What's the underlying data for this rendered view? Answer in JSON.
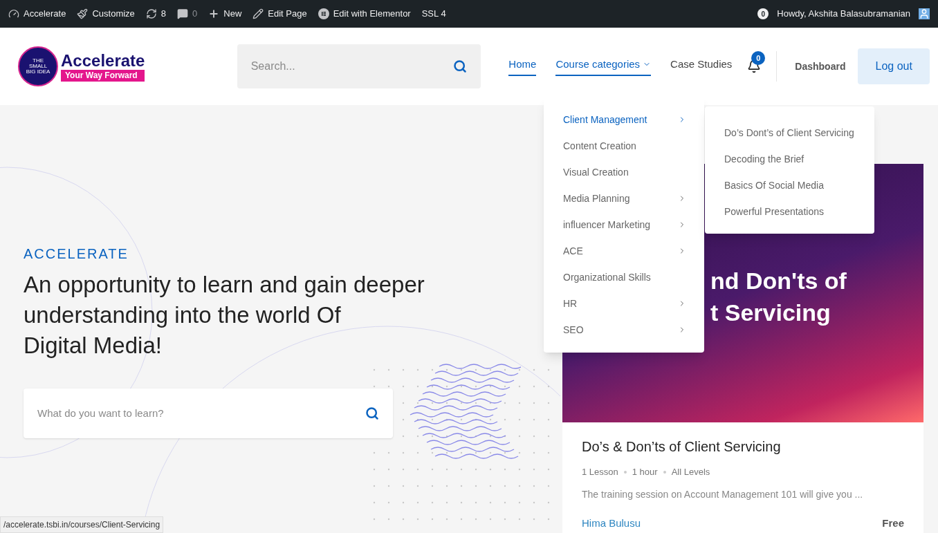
{
  "admin_bar": {
    "items": [
      {
        "kind": "site",
        "label": "Accelerate"
      },
      {
        "kind": "customize",
        "label": "Customize"
      },
      {
        "kind": "updates",
        "label": "8"
      },
      {
        "kind": "comments",
        "label": "0"
      },
      {
        "kind": "new",
        "label": "New"
      },
      {
        "kind": "edit",
        "label": "Edit Page"
      },
      {
        "kind": "elementor",
        "label": "Edit with Elementor"
      },
      {
        "kind": "text",
        "label": "SSL 4"
      }
    ],
    "notifications": "0",
    "greeting": "Howdy, Akshita Balasubramanian"
  },
  "header": {
    "logo": {
      "title": "Accelerate",
      "tagline": "Your Way Forward",
      "mark_lines": [
        "THE",
        "SMALL",
        "BIG IDEA"
      ]
    },
    "search": {
      "placeholder": "Search..."
    },
    "nav": [
      {
        "label": "Home",
        "active": true,
        "has_caret": false
      },
      {
        "label": "Course categories",
        "active": true,
        "has_caret": true
      },
      {
        "label": "Case Studies",
        "active": false,
        "has_caret": false
      }
    ],
    "bell_count": "0",
    "dashboard": "Dashboard",
    "logout": "Log out"
  },
  "menu": {
    "items": [
      {
        "label": "Client Management",
        "selected": true,
        "has_submenu": true
      },
      {
        "label": "Content Creation",
        "selected": false,
        "has_submenu": false
      },
      {
        "label": "Visual Creation",
        "selected": false,
        "has_submenu": false
      },
      {
        "label": "Media Planning",
        "selected": false,
        "has_submenu": true
      },
      {
        "label": "influencer Marketing",
        "selected": false,
        "has_submenu": true
      },
      {
        "label": "ACE",
        "selected": false,
        "has_submenu": true
      },
      {
        "label": "Organizational Skills",
        "selected": false,
        "has_submenu": false
      },
      {
        "label": "HR",
        "selected": false,
        "has_submenu": true
      },
      {
        "label": "SEO",
        "selected": false,
        "has_submenu": true
      }
    ],
    "submenu": [
      "Do’s Dont’s of Client Servicing",
      "Decoding the Brief",
      "Basics Of Social Media",
      "Powerful Presentations"
    ]
  },
  "hero": {
    "eyebrow": "ACCELERATE",
    "headline": [
      "An opportunity to learn and gain deeper",
      "understanding into the world Of",
      "Digital Media!"
    ],
    "search": {
      "placeholder": "What do you want to learn?"
    }
  },
  "course_card": {
    "banner_text": [
      "nd Don'ts of",
      "t Servicing"
    ],
    "title": "Do’s & Don’ts of Client Servicing",
    "meta": [
      "1 Lesson",
      "1 hour",
      "All Levels"
    ],
    "excerpt": "The training session on Account Management 101 will give you ...",
    "author": "Hima Bulusu",
    "price": "Free"
  },
  "status_url": "/accelerate.tsbi.in/courses/Client-Servicing"
}
